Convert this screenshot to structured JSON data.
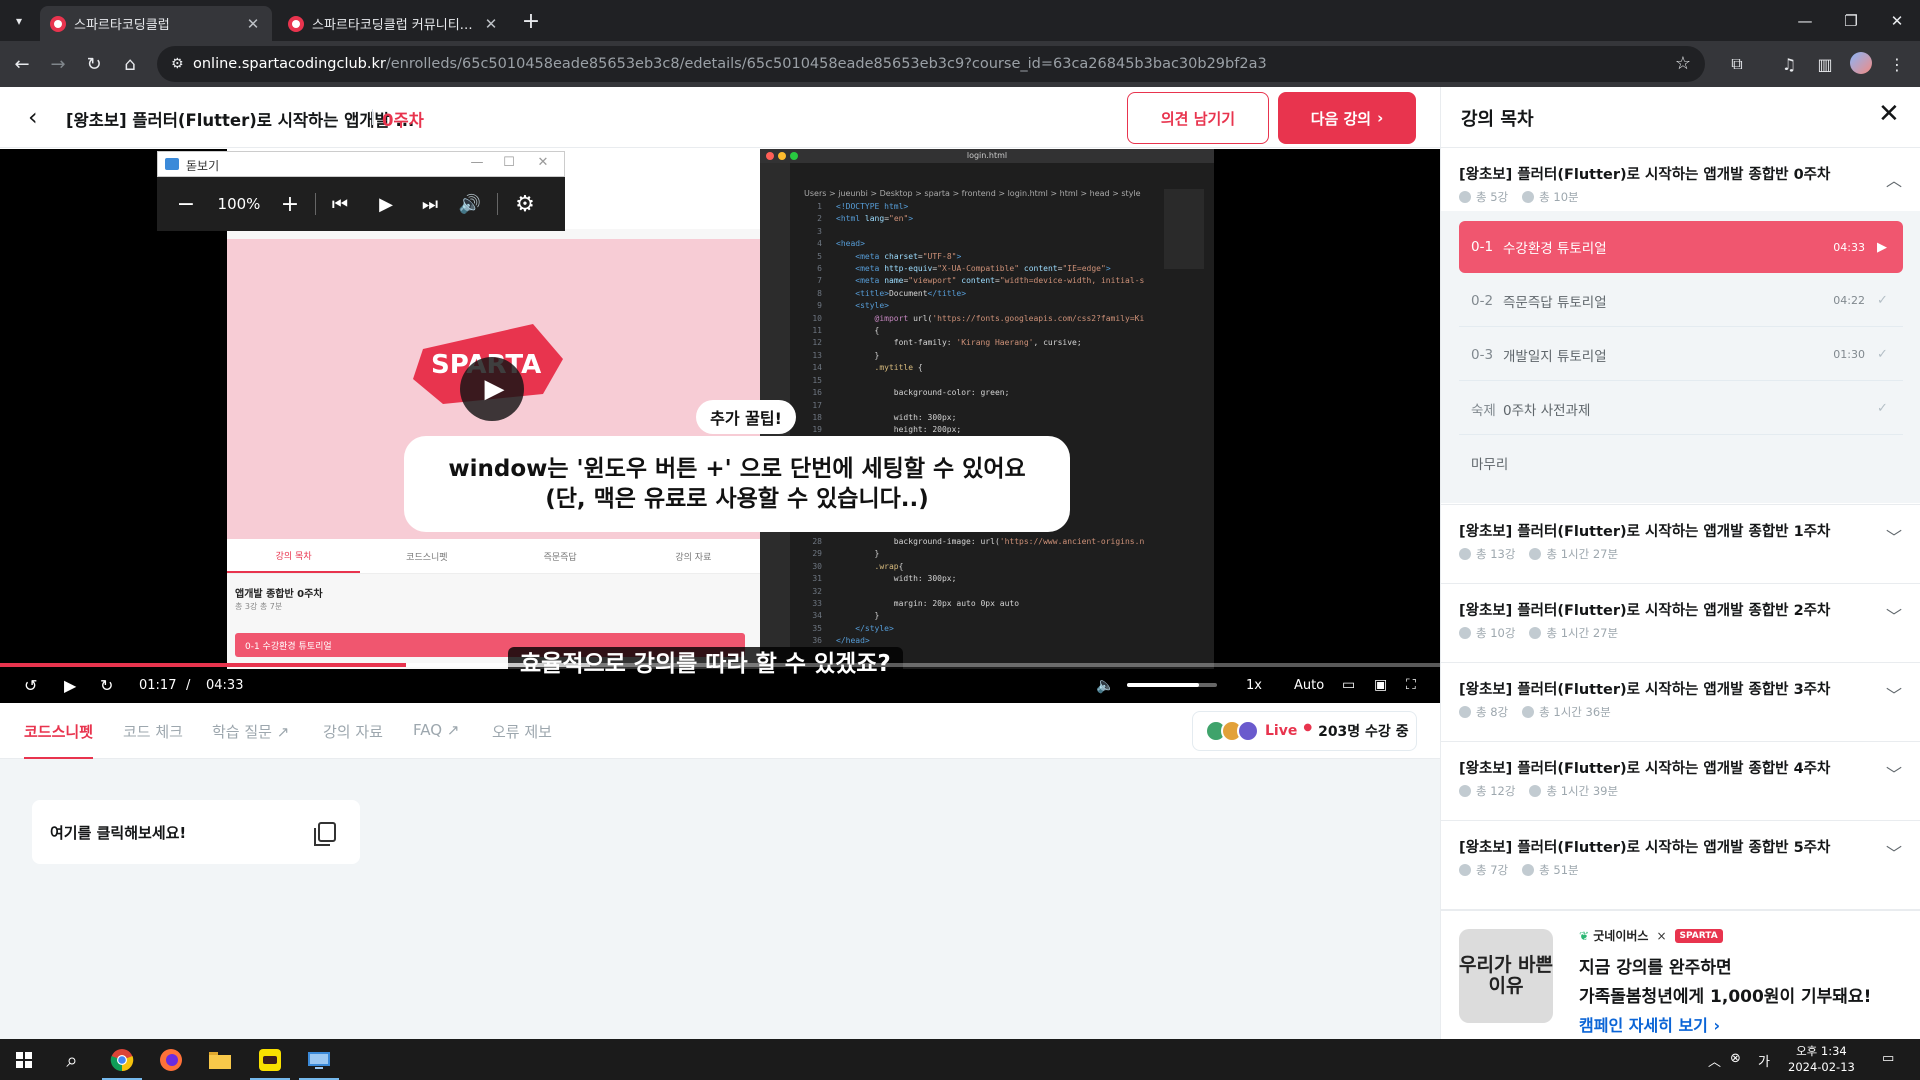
{
  "browser": {
    "tabs": [
      {
        "title": "스파르타코딩클럽",
        "active": true
      },
      {
        "title": "스파르타코딩클럽 커뮤니티 | 스",
        "active": false
      }
    ],
    "url_host": "online.spartacodingclub.kr",
    "url_path": "/enrolleds/65c5010458eade85653eb3c8/edetails/65c5010458eade85653eb3c9?course_id=63ca26845b3bac30b29bf2a3"
  },
  "header": {
    "course_title": "[왕초보] 플러터(Flutter)로 시작하는 앱개발 ...",
    "week": "0주차",
    "feedback_button": "의견 남기기",
    "next_button": "다음 강의"
  },
  "zoom_tool": {
    "title": "돋보기",
    "zoom_level": "100%"
  },
  "video": {
    "tip_badge": "추가 꿀팁!",
    "caption_line1": "window는 '윈도우 버튼 +' 으로 단번에 세팅할 수 있어요",
    "caption_line2": "(단, 맥은 유료로 사용할 수 있습니다..)",
    "subtitle": "효율적으로 강의를 따라 할 수 있겠죠?",
    "embedded_logo": "SPARTA",
    "embedded_tabs": [
      "강의 목차",
      "코드스니펫",
      "즉문즉답",
      "강의 자료"
    ],
    "embedded_week": "앱개발 종합반 0주차",
    "embedded_meta": "총 3강  총 7분",
    "embedded_lesson": "0-1  수강환경 튜토리얼",
    "vscode_title": "login.html",
    "vscode_breadcrumb": "Users > jueunbi > Desktop > sparta > frontend > login.html > html > head > style",
    "current_time": "01:17",
    "time_sep": "/",
    "total_time": "04:33",
    "progress_fraction": 0.282,
    "buffered_fraction": 0.41,
    "volume_fraction": 0.8,
    "speed": "1x",
    "quality": "Auto"
  },
  "subtabs": {
    "items": [
      "코드스니펫",
      "코드 체크",
      "학습 질문",
      "강의 자료",
      "FAQ",
      "오류 제보"
    ],
    "live_word": "Live",
    "live_count": "203명 수강 중"
  },
  "snippet": {
    "card_text": "여기를 클릭해보세요!"
  },
  "curriculum": {
    "title": "강의 목차",
    "weeks": [
      {
        "title": "[왕초보] 플러터(Flutter)로 시작하는 앱개발 종합반 0주차",
        "count": "총 5강",
        "time": "총 10분"
      },
      {
        "title": "[왕초보] 플러터(Flutter)로 시작하는 앱개발 종합반 1주차",
        "count": "총 13강",
        "time": "총 1시간 27분"
      },
      {
        "title": "[왕초보] 플러터(Flutter)로 시작하는 앱개발 종합반 2주차",
        "count": "총 10강",
        "time": "총 1시간 27분"
      },
      {
        "title": "[왕초보] 플러터(Flutter)로 시작하는 앱개발 종합반 3주차",
        "count": "총 8강",
        "time": "총 1시간 36분"
      },
      {
        "title": "[왕초보] 플러터(Flutter)로 시작하는 앱개발 종합반 4주차",
        "count": "총 12강",
        "time": "총 1시간 39분"
      },
      {
        "title": "[왕초보] 플러터(Flutter)로 시작하는 앱개발 종합반 5주차",
        "count": "총 7강",
        "time": "총 51분"
      }
    ],
    "lessons": [
      {
        "num": "0-1",
        "name": "수강환경 튜토리얼",
        "dur": "04:33"
      },
      {
        "num": "0-2",
        "name": "즉문즉답 튜토리얼",
        "dur": "04:22"
      },
      {
        "num": "0-3",
        "name": "개발일지 튜토리얼",
        "dur": "01:30"
      },
      {
        "num": "숙제",
        "name": "0주차 사전과제",
        "dur": ""
      },
      {
        "num": "",
        "name": "마무리",
        "dur": ""
      }
    ]
  },
  "banner": {
    "image_text": "우리가 바쁜 이유",
    "partner1": "굿네이버스",
    "partner_sep": "×",
    "partner2": "SPARTA",
    "line1": "지금 강의를 완주하면",
    "line2": "가족돌봄청년에게 1,000원이 기부돼요!",
    "link": "캠페인 자세히 보기"
  },
  "taskbar": {
    "time": "오후 1:34",
    "date": "2024-02-13"
  },
  "colors": {
    "accent": "#e8344e",
    "chrome_dark": "#202124",
    "chrome_toolbar": "#35363a",
    "link_blue": "#0a64d6"
  }
}
